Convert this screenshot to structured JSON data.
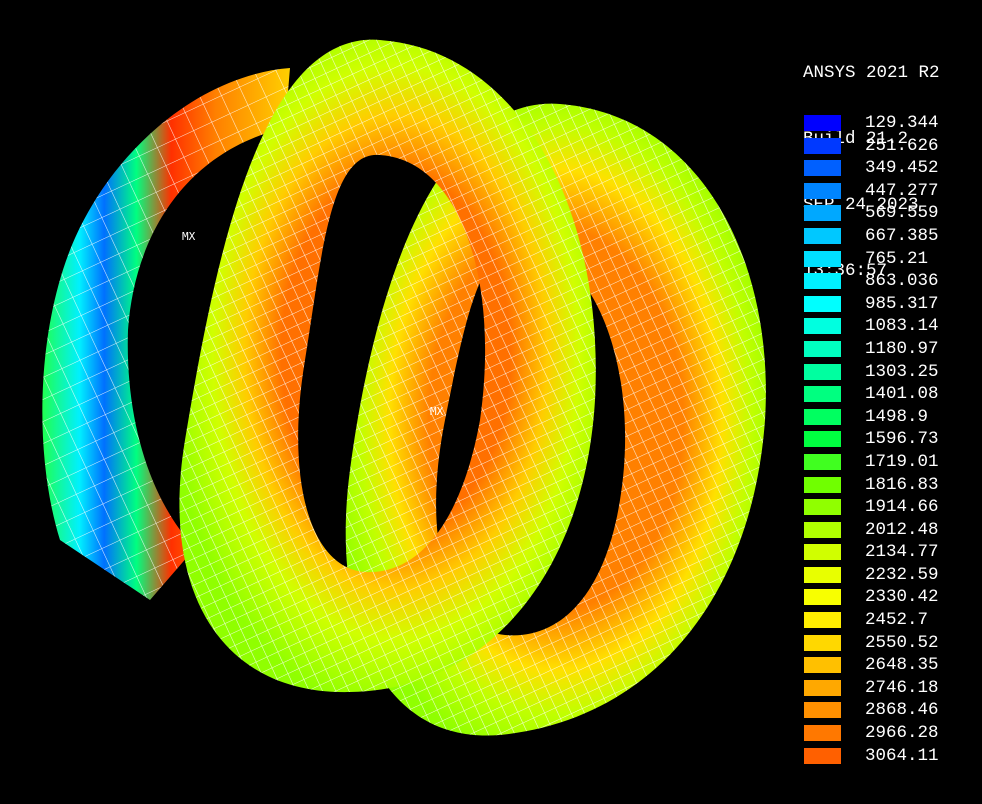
{
  "header": {
    "product": "ANSYS 2021 R2",
    "build": "Build 21.2",
    "date": "SEP 24 2023",
    "time": "13:36:57"
  },
  "markers": {
    "mx": "MX"
  },
  "legend": [
    {
      "value": "129.344",
      "color": "#0000ff"
    },
    {
      "value": "251.626",
      "color": "#0039ff"
    },
    {
      "value": "349.452",
      "color": "#0060ff"
    },
    {
      "value": "447.277",
      "color": "#0085ff"
    },
    {
      "value": "569.559",
      "color": "#00a8ff"
    },
    {
      "value": "667.385",
      "color": "#00c8ff"
    },
    {
      "value": "765.21",
      "color": "#00e0ff"
    },
    {
      "value": "863.036",
      "color": "#00f0ff"
    },
    {
      "value": "985.317",
      "color": "#00ffff"
    },
    {
      "value": "1083.14",
      "color": "#00ffe0"
    },
    {
      "value": "1180.97",
      "color": "#00ffc0"
    },
    {
      "value": "1303.25",
      "color": "#00ffa0"
    },
    {
      "value": "1401.08",
      "color": "#00ff80"
    },
    {
      "value": "1498.9",
      "color": "#00ff60"
    },
    {
      "value": "1596.73",
      "color": "#00ff40"
    },
    {
      "value": "1719.01",
      "color": "#40ff20"
    },
    {
      "value": "1816.83",
      "color": "#70ff00"
    },
    {
      "value": "1914.66",
      "color": "#90ff00"
    },
    {
      "value": "2012.48",
      "color": "#b0ff00"
    },
    {
      "value": "2134.77",
      "color": "#d0ff00"
    },
    {
      "value": "2232.59",
      "color": "#e8ff00"
    },
    {
      "value": "2330.42",
      "color": "#f8ff00"
    },
    {
      "value": "2452.7",
      "color": "#ffee00"
    },
    {
      "value": "2550.52",
      "color": "#ffd800"
    },
    {
      "value": "2648.35",
      "color": "#ffc000"
    },
    {
      "value": "2746.18",
      "color": "#ffa800"
    },
    {
      "value": "2868.46",
      "color": "#ff9000"
    },
    {
      "value": "2966.28",
      "color": "#ff7800"
    },
    {
      "value": "3064.11",
      "color": "#ff6000"
    }
  ]
}
